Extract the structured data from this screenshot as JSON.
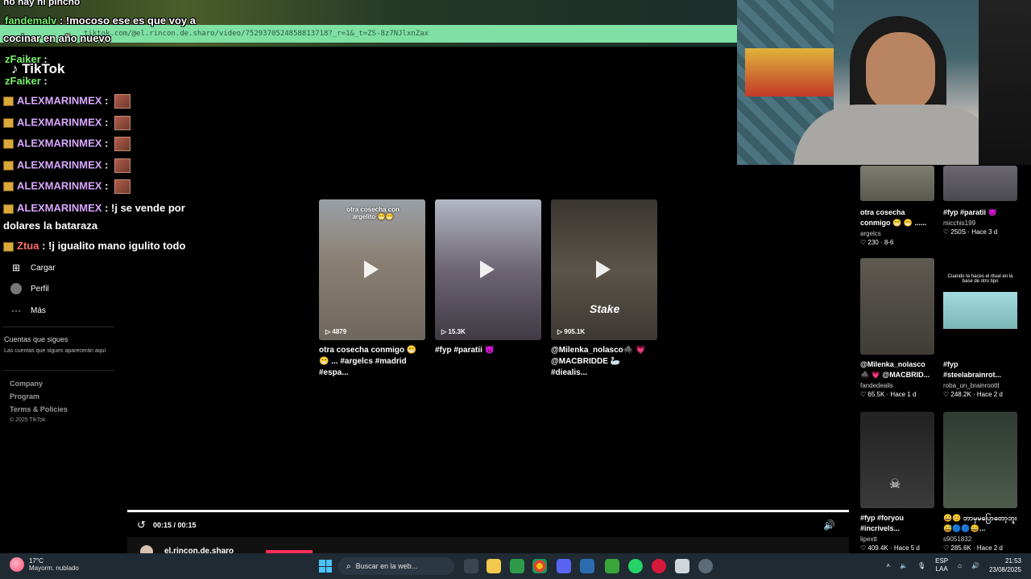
{
  "browser": {
    "url": "tiktok.com/@el.rincon.de.sharo/video/7529370524858813718?_r=1&_t=ZS-8z7NJlxnZax"
  },
  "chat": {
    "lines": [
      {
        "user": "fandemalv",
        "sep": " : ",
        "msg": "!mocoso ese es que voy a"
      },
      {
        "user": "",
        "sep": "",
        "msg": "cocinar en año nuevo"
      },
      {
        "user": "zFaiker",
        "sep": " : ",
        "msg": ""
      },
      {
        "user": "zFaiker",
        "sep": " : ",
        "msg": ""
      },
      {
        "user": "ALEXMARINMEX",
        "sep": " : ",
        "msg": ""
      },
      {
        "user": "ALEXMARINMEX",
        "sep": " : ",
        "msg": ""
      },
      {
        "user": "ALEXMARINMEX",
        "sep": " : ",
        "msg": ""
      },
      {
        "user": "ALEXMARINMEX",
        "sep": " : ",
        "msg": ""
      },
      {
        "user": "ALEXMARINMEX",
        "sep": " : ",
        "msg": ""
      },
      {
        "user": "ALEXMARINMEX",
        "sep": " : ",
        "msg": "!j se vende por"
      },
      {
        "user": "",
        "sep": "",
        "msg": "dolares la bataraza"
      },
      {
        "user": "Ztua",
        "sep": " : ",
        "msg": "!j igualito mano igulito todo"
      }
    ],
    "top_partial": "no hay ni pincho"
  },
  "sidebar": {
    "logo": "TikTok",
    "nav": [
      {
        "icon": "upload-icon",
        "label": "Cargar"
      },
      {
        "icon": "profile-icon",
        "label": "Perfil"
      },
      {
        "icon": "more-icon",
        "label": "Más"
      }
    ],
    "following_title": "Cuentas que sigues",
    "following_desc": "Las cuentas que sigues aparecerán aquí",
    "footer": [
      "Company",
      "Program",
      "Terms & Policies"
    ],
    "copyright": "© 2025 TikTok"
  },
  "results": [
    {
      "views": "4879",
      "title": "otra cosecha conmigo 😁 😁 ... #argelcs #madrid #espa...",
      "overlay": "otra cosecha con argelito 😁😁",
      "bg": "#8a8a7a"
    },
    {
      "views": "15.3K",
      "title": "#fyp #paratii 😈",
      "overlay": "",
      "bg": "#6f6a74"
    },
    {
      "views": "905.1K",
      "title": "@Milenka_nolasco🕷️ 💗 @MACBRIDDE 🦢 #diealis...",
      "overlay": "Stake",
      "bg": "#4e4a44"
    }
  ],
  "right_column": [
    {
      "title": "otra cosecha conmigo 😁 😁 ......",
      "author": "argelcs",
      "stats": "♡ 230 · 8-6",
      "bg": "#6b6a60"
    },
    {
      "title": "#fyp #paratii 😈",
      "author": "micchis199",
      "stats": "♡ 250S · Hace 3 d",
      "bg": "#5c5a60"
    },
    {
      "title": "@Milenka_nolasco 🕷️ 💗 @MACBRID...",
      "author": "fandedealis",
      "stats": "♡ 65.5K · Hace 1 d",
      "bg": "#55524b"
    },
    {
      "title": "#fyp #steelabrainrot...",
      "author": "roba_un_brainroottt",
      "stats": "♡ 248.2K · Hace 2 d",
      "bg": "#8fc7cf",
      "overlay": "Cuando te haces el ritual en la base de otro tipo"
    },
    {
      "title": "#fyp #foryou #incrivels...",
      "author": "lipextt",
      "stats": "♡ 409.4K · Hace 5 d",
      "bg": "#2a2a2a"
    },
    {
      "title": "😄😊 ဘာမှမပြောတော့ဘူး😅🔵🔵😄...",
      "author": "s9051832",
      "stats": "♡ 285.6K · Hace 2 d",
      "bg": "#3b4a3e"
    }
  ],
  "player": {
    "time": "00:15 / 00:15",
    "author": "el.rincon.de.sharo"
  },
  "taskbar": {
    "temp": "17°C",
    "weather": "Mayorm. nublado",
    "search": "Buscar en la web...",
    "lang1": "ESP",
    "lang2": "LAA",
    "time": "21:53",
    "date": "23/08/2025"
  }
}
